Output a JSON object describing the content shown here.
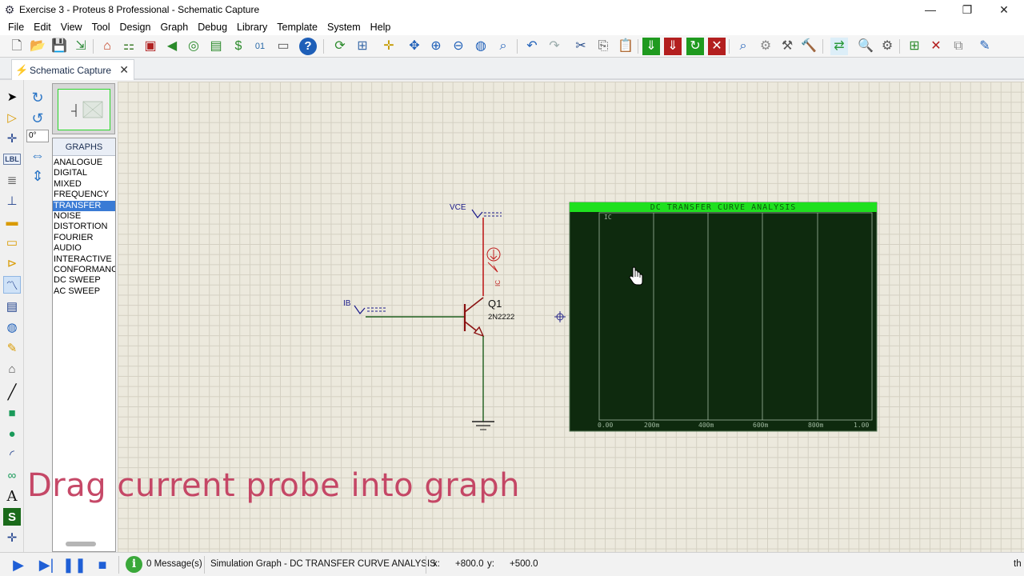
{
  "window": {
    "title": "Exercise 3 - Proteus 8 Professional - Schematic Capture",
    "controls": {
      "minimize": "—",
      "restore": "❐",
      "close": "✕"
    }
  },
  "menu": [
    "File",
    "Edit",
    "View",
    "Tool",
    "Design",
    "Graph",
    "Debug",
    "Library",
    "Template",
    "System",
    "Help"
  ],
  "tab": {
    "label": "Schematic Capture",
    "close": "✕"
  },
  "rotation": {
    "angle": "0°"
  },
  "selector": {
    "header": "GRAPHS",
    "items": [
      "ANALOGUE",
      "DIGITAL",
      "MIXED",
      "FREQUENCY",
      "TRANSFER",
      "NOISE",
      "DISTORTION",
      "FOURIER",
      "AUDIO",
      "INTERACTIVE",
      "CONFORMANCE",
      "DC SWEEP",
      "AC SWEEP"
    ],
    "selected": "TRANSFER"
  },
  "schematic": {
    "vce_label": "VCE",
    "ib_label": "IB",
    "ic_probe_label": "IC",
    "transistor_ref": "Q1",
    "transistor_part": "2N2222",
    "colors": {
      "wire": "#1f5f1f",
      "collector_wire": "#c02020",
      "component": "#8a1010",
      "label": "#1a1a8a"
    }
  },
  "graph": {
    "title": "DC TRANSFER CURVE ANALYSIS",
    "trace_label": "IC",
    "x_ticks": [
      "0.00",
      "200m",
      "400m",
      "600m",
      "800m",
      "1.00"
    ],
    "colors": {
      "header": "#1fe01f",
      "background": "#0e2a0e",
      "grid": "#9fb89f"
    }
  },
  "caption": "Drag current probe into graph",
  "status": {
    "messages": "0 Message(s)",
    "info": "Simulation Graph - DC TRANSFER CURVE ANALYSIS",
    "x_label": "x:",
    "x_value": "+800.0",
    "y_label": "y:",
    "y_value": "+500.0",
    "units": "th"
  }
}
